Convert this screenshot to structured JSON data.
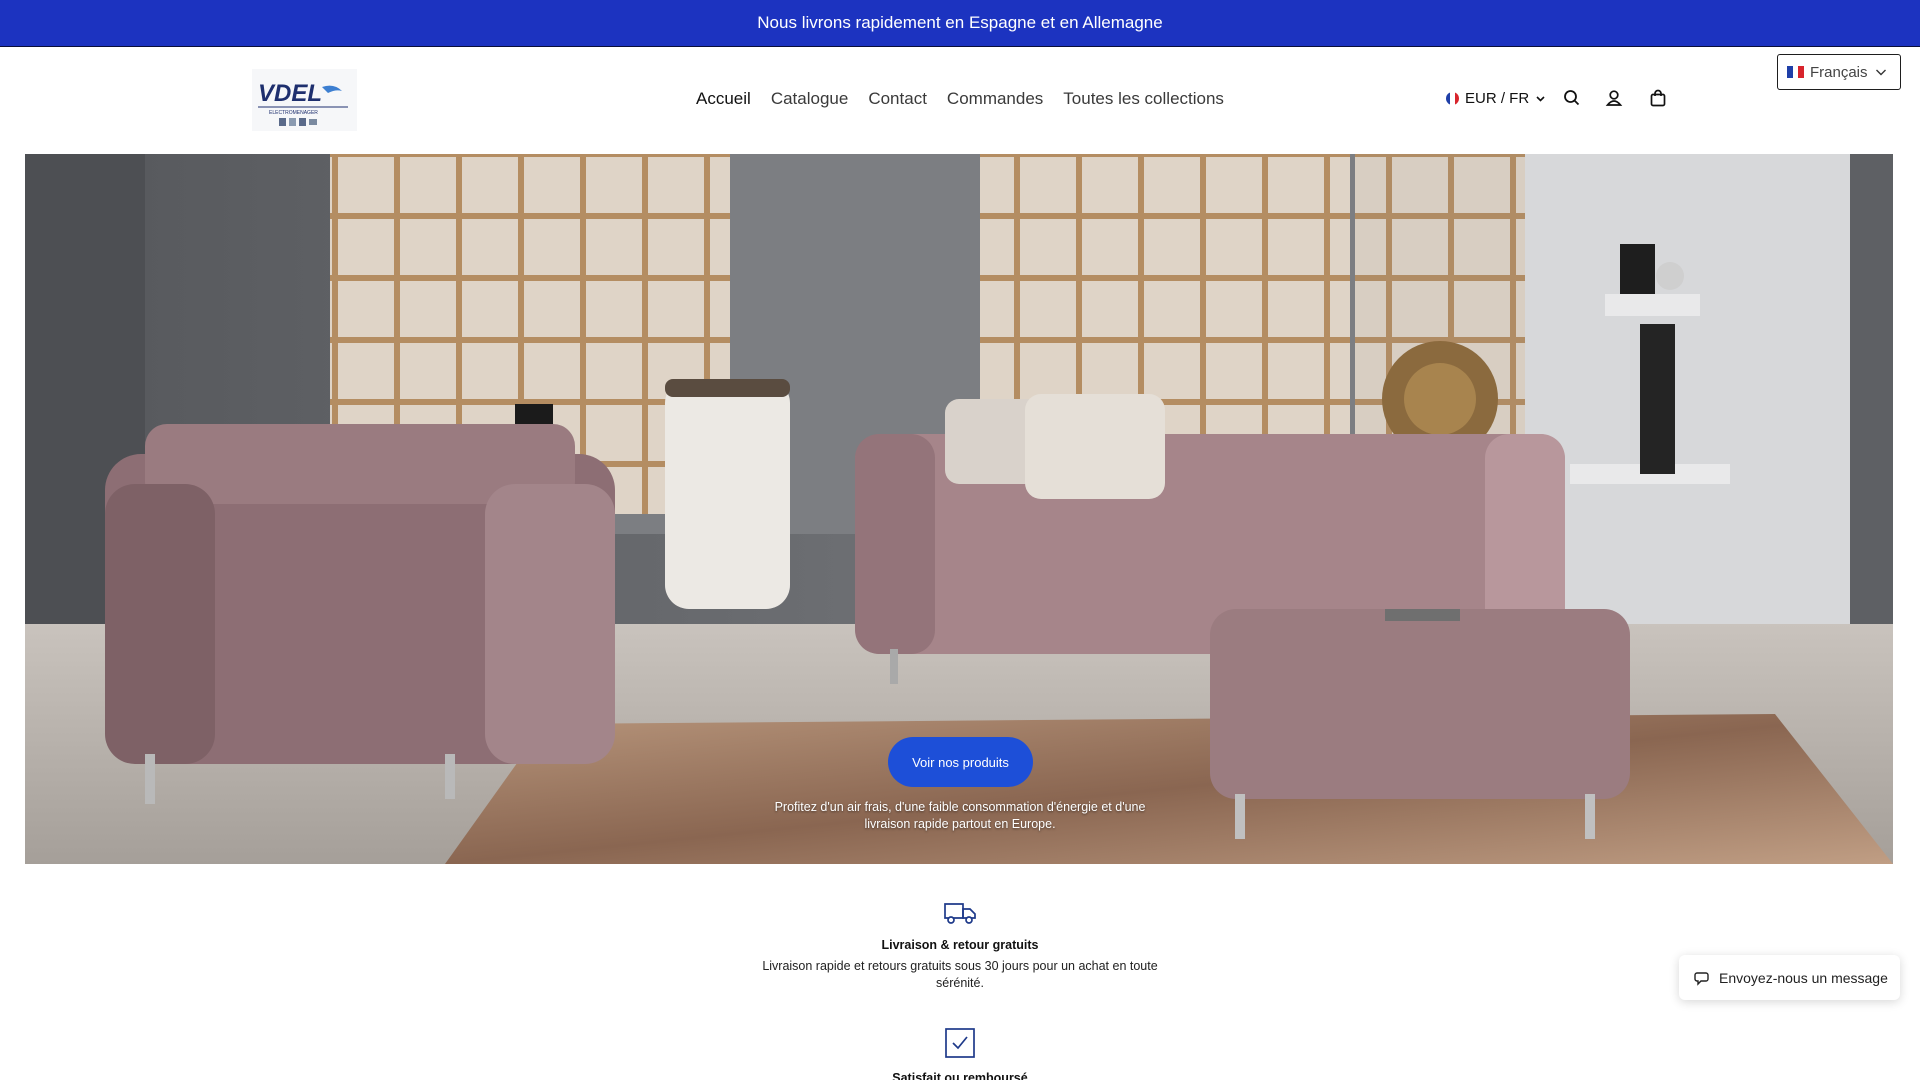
{
  "announcement": {
    "text": "Nous livrons rapidement en Espagne et en Allemagne"
  },
  "header": {
    "logo": {
      "brand": "VDEL",
      "tagline": "ELECTROMENAGER"
    },
    "nav": [
      {
        "label": "Accueil",
        "active": true
      },
      {
        "label": "Catalogue",
        "active": false
      },
      {
        "label": "Contact",
        "active": false
      },
      {
        "label": "Commandes",
        "active": false
      },
      {
        "label": "Toutes les collections",
        "active": false
      }
    ],
    "locale_label": "EUR / FR",
    "icons": [
      "flag-icon",
      "chevron-down-icon",
      "search-icon",
      "account-icon",
      "cart-icon"
    ]
  },
  "language_selector": {
    "value": "Français"
  },
  "hero": {
    "cta_label": "Voir nos produits",
    "text": "Profitez d'un air frais, d'une faible consommation d'énergie et d'une livraison rapide partout en Europe."
  },
  "features": [
    {
      "icon": "truck-icon",
      "title": "Livraison & retour gratuits",
      "text": "Livraison rapide et retours gratuits sous 30 jours pour un achat en toute sérénité."
    },
    {
      "icon": "checkbox-icon",
      "title": "Satisfait ou remboursé",
      "text": ""
    }
  ],
  "chat": {
    "label": "Envoyez-nous un message"
  },
  "colors": {
    "announcement_bg": "#1c33c0",
    "cta_bg": "#1d4fd8",
    "accent": "#1e3a8a"
  }
}
